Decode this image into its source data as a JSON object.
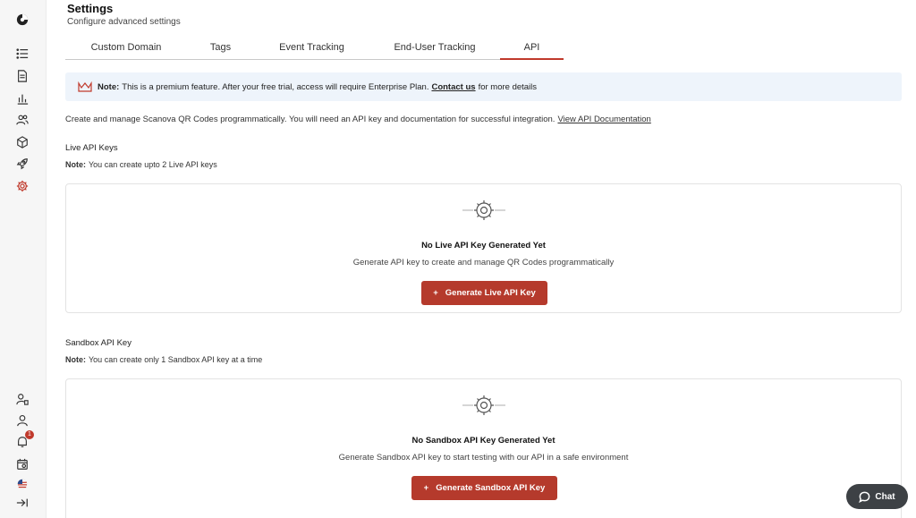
{
  "header": {
    "title": "Settings",
    "subtitle": "Configure advanced settings"
  },
  "tabs": [
    {
      "label": "Custom Domain"
    },
    {
      "label": "Tags"
    },
    {
      "label": "Event Tracking"
    },
    {
      "label": "End-User Tracking"
    },
    {
      "label": "API",
      "active": true
    }
  ],
  "banner": {
    "icon": "crown-icon",
    "prefix": "Note:",
    "text": "This is a premium feature. After your free trial, access will require Enterprise Plan.",
    "link": "Contact us",
    "suffix": "for more details"
  },
  "intro": {
    "text": "Create and manage Scanova QR Codes programmatically. You will need an API key and documentation for successful integration.",
    "link": "View API Documentation"
  },
  "live": {
    "title": "Live API Keys",
    "note_prefix": "Note:",
    "note": "You can create upto 2 Live API keys",
    "empty_title": "No Live API Key Generated Yet",
    "empty_desc": "Generate API key to create and manage QR Codes programmatically",
    "button_icon": "+",
    "button": "Generate Live API Key"
  },
  "sandbox": {
    "title": "Sandbox API Key",
    "note_prefix": "Note:",
    "note": "You can create only 1 Sandbox API key at a time",
    "empty_title": "No Sandbox API Key Generated Yet",
    "empty_desc": "Generate Sandbox API key to start testing with our API in a safe environment",
    "button_icon": "+",
    "button": "Generate Sandbox API Key"
  },
  "sidebar": {
    "notification_count": "1"
  },
  "chat": {
    "label": "Chat"
  },
  "colors": {
    "accent": "#b53a2c",
    "banner_bg": "#eef4fb",
    "chat_bg": "#3d4145"
  }
}
